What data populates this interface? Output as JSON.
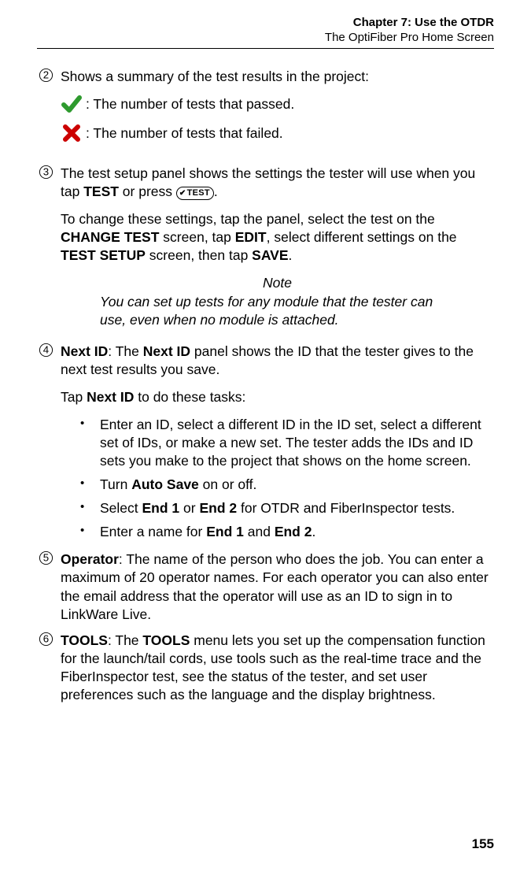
{
  "header": {
    "chapter": "Chapter 7: Use the OTDR",
    "subtitle": "The OptiFiber Pro Home Screen"
  },
  "footer": {
    "page_number": "155"
  },
  "items": {
    "i2": {
      "num": "2",
      "lead": "Shows a summary of the test results in the project:",
      "pass": ": The number of tests that passed.",
      "fail": ": The number of tests that failed."
    },
    "i3": {
      "num": "3",
      "lead_a": "The test setup panel shows the settings the tester will use when you tap ",
      "lead_b_bold": "TEST",
      "lead_c": " or press ",
      "key_label": "TEST",
      "lead_d": ".",
      "para2_a": "To change these settings, tap the panel, select the test on the ",
      "para2_b_bold": "CHANGE TEST",
      "para2_c": " screen, tap ",
      "para2_d_bold": "EDIT",
      "para2_e": ", select different settings on the ",
      "para2_f_bold": "TEST SETUP",
      "para2_g": " screen, then tap ",
      "para2_h_bold": "SAVE",
      "para2_i": ".",
      "note_head": "Note",
      "note_body": "You can set up tests for any module that the tester can use, even when no module is attached."
    },
    "i4": {
      "num": "4",
      "lead_a_bold": "Next ID",
      "lead_b": ": The ",
      "lead_c_bold": "Next ID",
      "lead_d": " panel shows the ID that the tester gives to the next test results you save.",
      "para2_a": "Tap ",
      "para2_b_bold": "Next ID",
      "para2_c": " to do these tasks:",
      "bul1": "Enter an ID, select a different ID in the ID set, select a different set of IDs, or make a new set. The tester adds the IDs and ID sets you make to the project that shows on the home screen.",
      "bul2_a": "Turn ",
      "bul2_b_bold": "Auto Save",
      "bul2_c": " on or off.",
      "bul3_a": "Select ",
      "bul3_b_bold": "End 1",
      "bul3_c": " or ",
      "bul3_d_bold": "End 2",
      "bul3_e": " for OTDR and FiberInspector tests.",
      "bul4_a": "Enter a name for ",
      "bul4_b_bold": "End 1",
      "bul4_c": " and ",
      "bul4_d_bold": "End 2",
      "bul4_e": "."
    },
    "i5": {
      "num": "5",
      "lead_a_bold": "Operator",
      "lead_b": ": The name of the person who does the job. You can enter a maximum of 20 operator names. For each operator you can also enter the email address that the operator will use as an ID to sign in to LinkWare Live."
    },
    "i6": {
      "num": "6",
      "lead_a_bold": "TOOLS",
      "lead_b": ": The ",
      "lead_c_bold": "TOOLS",
      "lead_d": " menu lets you set up the compensation function for the launch/tail cords, use tools such as the real-time trace and the FiberInspector test, see the status of the tester, and set user preferences such as the language and the display brightness."
    }
  }
}
